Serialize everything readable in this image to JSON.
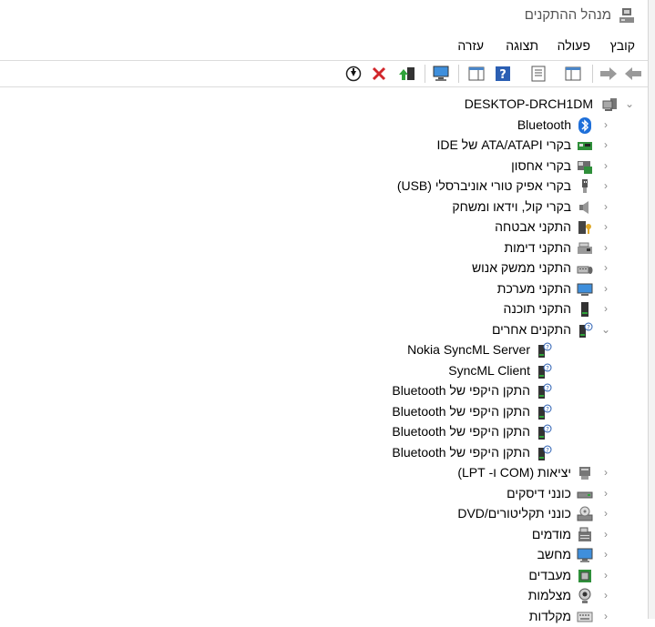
{
  "window": {
    "title": "מנהל ההתקנים"
  },
  "menu": [
    {
      "label": "קובץ"
    },
    {
      "label": "פעולה"
    },
    {
      "label": "תצוגה"
    },
    {
      "label": "עזרה"
    }
  ],
  "toolbar": {
    "buttons": [
      {
        "icon": "back-arrow-icon"
      },
      {
        "icon": "forward-arrow-icon"
      },
      {
        "icon": "console-tree-icon"
      },
      {
        "icon": "properties-icon"
      },
      {
        "icon": "help-icon"
      },
      {
        "icon": "show-hidden-icon"
      },
      {
        "icon": "scan-hardware-icon"
      },
      {
        "icon": "update-driver-icon"
      },
      {
        "icon": "uninstall-icon"
      },
      {
        "icon": "enable-device-icon"
      }
    ]
  },
  "tree": {
    "root": "DESKTOP-DRCH1DM",
    "items": [
      {
        "label": "Bluetooth",
        "icon": "bluetooth-icon",
        "expanded": false,
        "level": 1
      },
      {
        "label": "בקרי ATA/ATAPI של IDE",
        "icon": "ide-controller-icon",
        "expanded": false,
        "level": 1
      },
      {
        "label": "בקרי אחסון",
        "icon": "storage-controller-icon",
        "expanded": false,
        "level": 1
      },
      {
        "label": "בקרי אפיק טורי אוניברסלי (USB)",
        "icon": "usb-icon",
        "expanded": false,
        "level": 1
      },
      {
        "label": "בקרי קול, וידאו ומשחק",
        "icon": "speaker-icon",
        "expanded": false,
        "level": 1
      },
      {
        "label": "התקני אבטחה",
        "icon": "security-device-icon",
        "expanded": false,
        "level": 1
      },
      {
        "label": "התקני דימות",
        "icon": "imaging-device-icon",
        "expanded": false,
        "level": 1
      },
      {
        "label": "התקני ממשק אנוש",
        "icon": "hid-icon",
        "expanded": false,
        "level": 1
      },
      {
        "label": "התקני מערכת",
        "icon": "system-device-icon",
        "expanded": false,
        "level": 1
      },
      {
        "label": "התקני תוכנה",
        "icon": "software-device-icon",
        "expanded": false,
        "level": 1
      },
      {
        "label": "התקנים אחרים",
        "icon": "unknown-device-icon",
        "expanded": true,
        "level": 1
      },
      {
        "label": "Nokia SyncML Server",
        "icon": "unknown-device-icon",
        "level": 2
      },
      {
        "label": "SyncML Client",
        "icon": "unknown-device-icon",
        "level": 2
      },
      {
        "label": "התקן היקפי של Bluetooth",
        "icon": "unknown-device-icon",
        "level": 2
      },
      {
        "label": "התקן היקפי של Bluetooth",
        "icon": "unknown-device-icon",
        "level": 2
      },
      {
        "label": "התקן היקפי של Bluetooth",
        "icon": "unknown-device-icon",
        "level": 2
      },
      {
        "label": "התקן היקפי של Bluetooth",
        "icon": "unknown-device-icon",
        "level": 2
      },
      {
        "label": "יציאות (COM ו- LPT)",
        "icon": "port-icon",
        "expanded": false,
        "level": 1
      },
      {
        "label": "כונני דיסקים",
        "icon": "disk-drive-icon",
        "expanded": false,
        "level": 1
      },
      {
        "label": "כונני תקליטורים/DVD",
        "icon": "dvd-drive-icon",
        "expanded": false,
        "level": 1
      },
      {
        "label": "מודמים",
        "icon": "modem-icon",
        "expanded": false,
        "level": 1
      },
      {
        "label": "מחשב",
        "icon": "computer-icon",
        "expanded": false,
        "level": 1
      },
      {
        "label": "מעבדים",
        "icon": "processor-icon",
        "expanded": false,
        "level": 1
      },
      {
        "label": "מצלמות",
        "icon": "camera-icon",
        "expanded": false,
        "level": 1
      },
      {
        "label": "מקלדות",
        "icon": "keyboard-icon",
        "expanded": false,
        "level": 1
      }
    ]
  },
  "colors": {
    "accent": "#0078d7",
    "text": "#000000",
    "chevron": "#8a8a8a"
  }
}
